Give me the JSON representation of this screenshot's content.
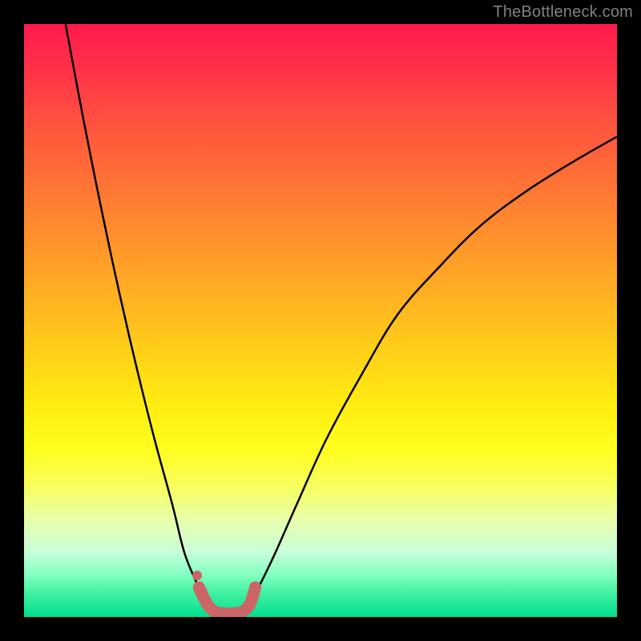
{
  "watermark": {
    "text": "TheBottleneck.com"
  },
  "colors": {
    "frame": "#000000",
    "curve": "#000000",
    "highlight": "#cc6666",
    "gradient_top": "#ff1a4d",
    "gradient_bottom": "#00e090"
  },
  "chart_data": {
    "type": "line",
    "title": "",
    "xlabel": "",
    "ylabel": "",
    "xlim": [
      0,
      100
    ],
    "ylim": [
      0,
      100
    ],
    "notes": "Bottleneck-style V-curve. y=100 maps to top (red), y=0 to bottom (green). Axes, ticks, and legend are not shown in image. Values estimated from pixel positions.",
    "series": [
      {
        "name": "left-branch",
        "x": [
          7,
          10,
          13,
          16,
          19,
          22,
          25,
          27,
          29,
          30.5,
          32
        ],
        "y": [
          100,
          84,
          69,
          55,
          42,
          30,
          19,
          11,
          6,
          3,
          1
        ]
      },
      {
        "name": "right-branch",
        "x": [
          37,
          39,
          42,
          46,
          51,
          57,
          63,
          70,
          77,
          85,
          93,
          100
        ],
        "y": [
          1,
          4,
          10,
          19,
          30,
          41,
          51,
          59,
          66,
          72,
          77,
          81
        ]
      },
      {
        "name": "valley-highlight",
        "x": [
          29.5,
          31,
          32.5,
          34.5,
          36.5,
          38,
          39
        ],
        "y": [
          5,
          2,
          0.8,
          0.6,
          0.8,
          2,
          5
        ]
      }
    ],
    "highlight_points": {
      "x": [
        29.2
      ],
      "y": [
        7
      ]
    }
  }
}
